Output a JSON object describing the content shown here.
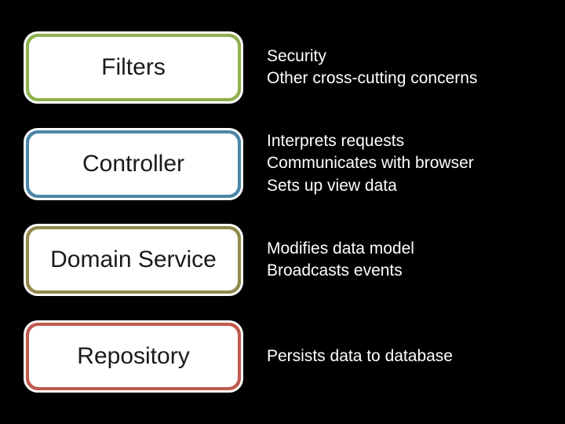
{
  "layers": [
    {
      "id": "filters",
      "label": "Filters",
      "color_class": "c-green",
      "lines": [
        "Security",
        "Other cross-cutting concerns"
      ]
    },
    {
      "id": "controller",
      "label": "Controller",
      "color_class": "c-blue",
      "lines": [
        "Interprets requests",
        "Communicates with browser",
        "Sets up view data"
      ]
    },
    {
      "id": "domain-service",
      "label": "Domain Service",
      "color_class": "c-olive",
      "lines": [
        "Modifies data model",
        "Broadcasts events"
      ]
    },
    {
      "id": "repository",
      "label": "Repository",
      "color_class": "c-red",
      "lines": [
        "Persists data to database"
      ]
    }
  ]
}
